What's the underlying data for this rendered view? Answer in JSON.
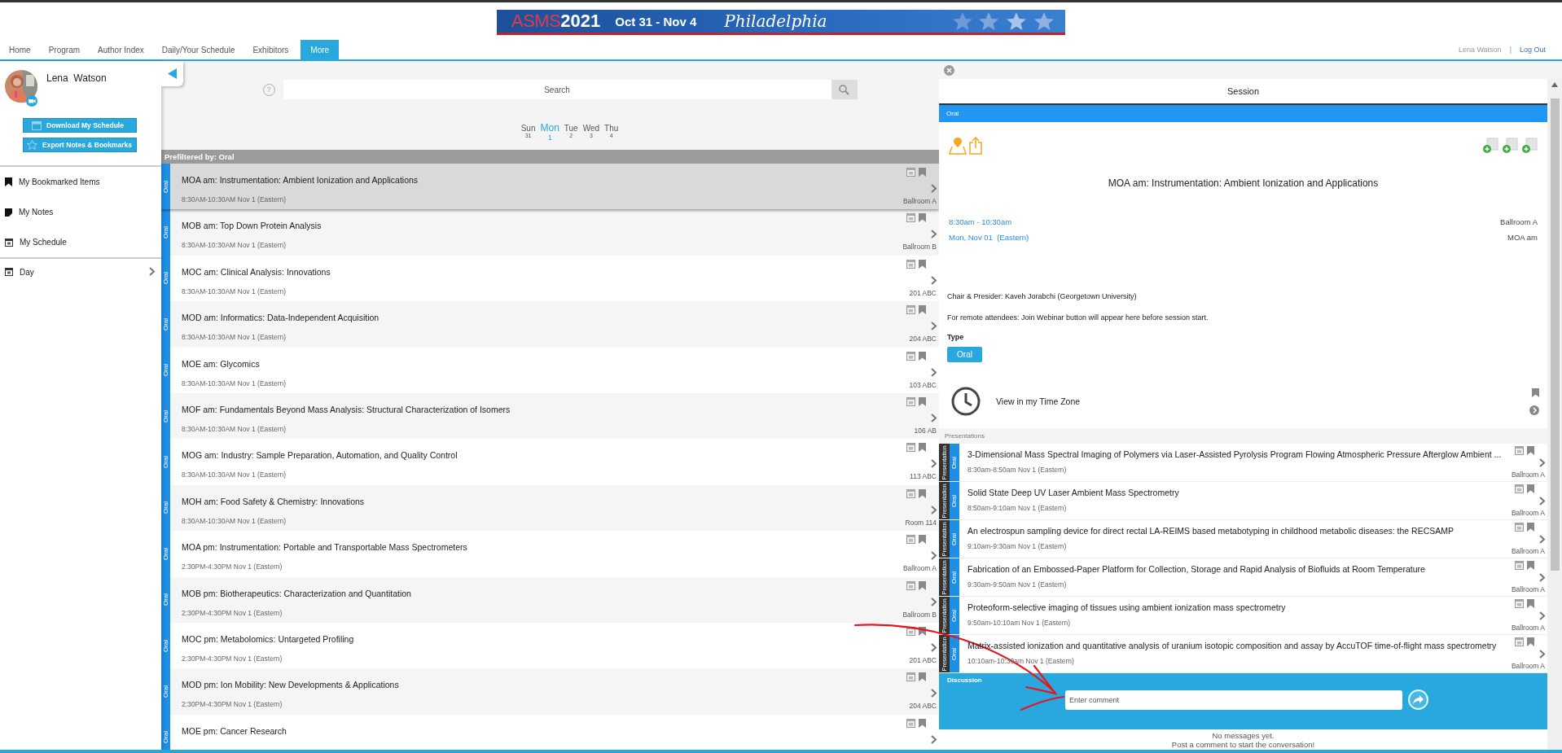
{
  "banner": {
    "acronym": "ASMS",
    "year": "2021",
    "dates": "Oct 31 - Nov 4",
    "city": "Philadelphia"
  },
  "nav": {
    "tabs": [
      {
        "label": "Home",
        "selected": false
      },
      {
        "label": "Program",
        "selected": false
      },
      {
        "label": "Author Index",
        "selected": false
      },
      {
        "label": "Daily/Your Schedule",
        "selected": false
      },
      {
        "label": "Exhibitors",
        "selected": false
      },
      {
        "label": "More",
        "selected": true
      }
    ],
    "user": "Lena Watson",
    "separator": "|",
    "logout": "Log Out"
  },
  "sidebar": {
    "user_name": "Lena  Watson",
    "buttons": [
      {
        "label": "Download My Schedule",
        "kind": "calendar"
      },
      {
        "label": "Export Notes & Bookmarks",
        "kind": "star"
      }
    ],
    "items": [
      {
        "label": "My Bookmarked Items",
        "kind": "bookmark"
      },
      {
        "label": "My Notes",
        "kind": "note"
      },
      {
        "label": "My Schedule",
        "kind": "calendar"
      }
    ],
    "day": {
      "label": "Day",
      "expanded": false
    }
  },
  "search": {
    "help": "?",
    "placeholder": "Search"
  },
  "days": [
    {
      "name": "Sun",
      "date": "31",
      "selected": false
    },
    {
      "name": "Mon",
      "date": "1",
      "selected": true
    },
    {
      "name": "Tue",
      "date": "2",
      "selected": false
    },
    {
      "name": "Wed",
      "date": "3",
      "selected": false
    },
    {
      "name": "Thu",
      "date": "4",
      "selected": false
    }
  ],
  "filter_label": "Prefiltered by: Oral",
  "sessions": [
    {
      "tag": "Oral",
      "title": "MOA am: Instrumentation: Ambient Ionization and Applications",
      "time": "8:30AM-10:30AM Nov 1 (Eastern)",
      "room": "Ballroom A",
      "selected": true
    },
    {
      "tag": "Oral",
      "title": "MOB am: Top Down Protein Analysis",
      "time": "8:30AM-10:30AM Nov 1 (Eastern)",
      "room": "Ballroom B",
      "selected": false
    },
    {
      "tag": "Oral",
      "title": "MOC am: Clinical Analysis: Innovations",
      "time": "8:30AM-10:30AM Nov 1 (Eastern)",
      "room": "201 ABC",
      "selected": false
    },
    {
      "tag": "Oral",
      "title": "MOD am: Informatics: Data-Independent Acquisition",
      "time": "8:30AM-10:30AM Nov 1 (Eastern)",
      "room": "204 ABC",
      "selected": false
    },
    {
      "tag": "Oral",
      "title": "MOE am: Glycomics",
      "time": "8:30AM-10:30AM Nov 1 (Eastern)",
      "room": "103 ABC",
      "selected": false
    },
    {
      "tag": "Oral",
      "title": "MOF am: Fundamentals Beyond Mass Analysis: Structural Characterization of Isomers",
      "time": "8:30AM-10:30AM Nov 1 (Eastern)",
      "room": "106 AB",
      "selected": false
    },
    {
      "tag": "Oral",
      "title": "MOG am: Industry: Sample Preparation, Automation, and Quality Control",
      "time": "8:30AM-10:30AM Nov 1 (Eastern)",
      "room": "113 ABC",
      "selected": false
    },
    {
      "tag": "Oral",
      "title": "MOH am: Food Safety & Chemistry: Innovations",
      "time": "8:30AM-10:30AM Nov 1 (Eastern)",
      "room": "Room 114",
      "selected": false
    },
    {
      "tag": "Oral",
      "title": "MOA pm: Instrumentation: Portable and Transportable Mass Spectrometers",
      "time": "2:30PM-4:30PM Nov 1 (Eastern)",
      "room": "Ballroom A",
      "selected": false
    },
    {
      "tag": "Oral",
      "title": "MOB pm: Biotherapeutics: Characterization and Quantitation",
      "time": "2:30PM-4:30PM Nov 1 (Eastern)",
      "room": "Ballroom B",
      "selected": false
    },
    {
      "tag": "Oral",
      "title": "MOC pm: Metabolomics: Untargeted Profiling",
      "time": "2:30PM-4:30PM Nov 1 (Eastern)",
      "room": "201 ABC",
      "selected": false
    },
    {
      "tag": "Oral",
      "title": "MOD pm: Ion Mobility: New Developments & Applications",
      "time": "2:30PM-4:30PM Nov 1 (Eastern)",
      "room": "204 ABC",
      "selected": false
    },
    {
      "tag": "Oral",
      "title": "MOE pm: Cancer Research",
      "selected": false
    }
  ],
  "detail": {
    "header": "Session",
    "tag": "Oral",
    "title": "MOA am: Instrumentation: Ambient Ionization and Applications",
    "time": "8:30am - 10:30am",
    "date": "Mon, Nov 01  (Eastern)",
    "room": "Ballroom A",
    "code": "MOA am",
    "chair": "Chair & Presider: Kaveh Jorabchi (Georgetown University)",
    "remote_note": "For remote attendees: Join Webinar button will appear here before session start.",
    "type_label": "Type",
    "type_chip": "Oral",
    "timezone_link": "View in my Time Zone"
  },
  "presentations": {
    "label": "Presentations",
    "items": [
      {
        "kind_tag": "Presentation",
        "tag": "Oral",
        "title": "3-Dimensional Mass Spectral Imaging of Polymers via Laser-Assisted Pyrolysis Program Flowing Atmospheric Pressure Afterglow Ambient ...",
        "time": "8:30am-8:50am Nov 1 (Eastern)",
        "room": "Ballroom A"
      },
      {
        "kind_tag": "Presentation",
        "tag": "Oral",
        "title": "Solid State Deep UV Laser Ambient Mass Spectrometry",
        "time": "8:50am-9:10am Nov 1 (Eastern)",
        "room": "Ballroom A"
      },
      {
        "kind_tag": "Presentation",
        "tag": "Oral",
        "title": "An electrospun sampling device for direct rectal LA-REIMS based metabotyping in childhood metabolic diseases: the RECSAMP",
        "time": "9:10am-9:30am Nov 1 (Eastern)",
        "room": "Ballroom A"
      },
      {
        "kind_tag": "Presentation",
        "tag": "Oral",
        "title": "Fabrication of an Embossed-Paper Platform for Collection, Storage and Rapid Analysis of Biofluids at Room Temperature",
        "time": "9:30am-9:50am Nov 1 (Eastern)",
        "room": "Ballroom A"
      },
      {
        "kind_tag": "Presentation",
        "tag": "Oral",
        "title": "Proteoform-selective imaging of tissues using ambient ionization mass spectrometry",
        "time": "9:50am-10:10am Nov 1 (Eastern)",
        "room": "Ballroom A"
      },
      {
        "kind_tag": "Presentation",
        "tag": "Oral",
        "title": "Matrix-assisted ionization and quantitative analysis of uranium isotopic composition and assay by AccuTOF time-of-flight mass spectrometry",
        "time": "10:10am-10:30am Nov 1 (Eastern)",
        "room": "Ballroom A"
      }
    ]
  },
  "discussion": {
    "label": "Discussion",
    "placeholder": "Enter comment",
    "empty_title": "No messages yet.",
    "empty_hint": "Post a comment to start the conversation!"
  }
}
